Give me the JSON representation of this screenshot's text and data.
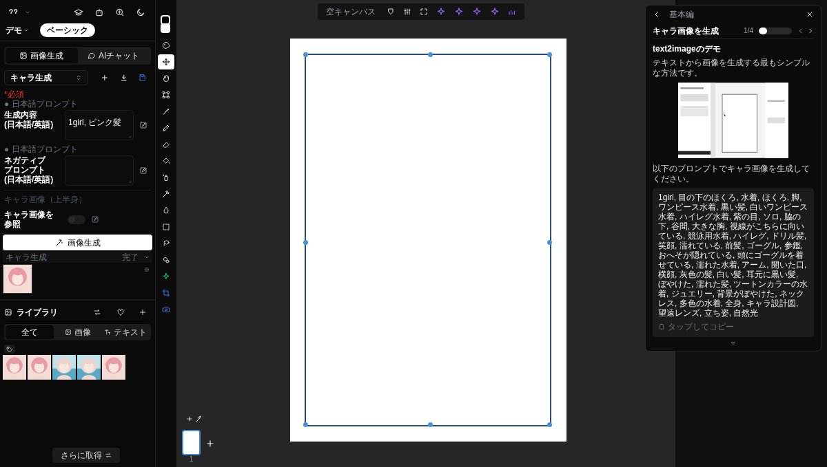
{
  "header": {
    "project": "デモ",
    "plan": "ベーシック"
  },
  "mode_tabs": [
    {
      "label": "画像生成",
      "selected": true
    },
    {
      "label": "AIチャット",
      "selected": false
    }
  ],
  "preset": {
    "value": "キャラ生成"
  },
  "prompts": [
    {
      "required": "*必須",
      "hint": "● 日本語プロンプト",
      "label_lines": [
        "生成内容",
        "(日本語/英語)"
      ],
      "value": "1girl, ピンク髪"
    },
    {
      "hint": "● 日本語プロンプト",
      "label_lines": [
        "ネガティブ",
        "プロンプト",
        "(日本語/英語)"
      ]
    }
  ],
  "char_section": "キャラ画像（上半身）",
  "reference": {
    "label_lines": [
      "キャラ画像を",
      "参照"
    ],
    "on": false
  },
  "generate_button": "画像生成",
  "job": {
    "name": "キャラ生成",
    "status": "完了"
  },
  "library": {
    "title": "ライブラリ",
    "tabs": [
      {
        "label": "全て",
        "selected": true
      },
      {
        "label": "画像",
        "selected": false
      },
      {
        "label": "テキスト",
        "selected": false
      }
    ],
    "more_button": "さらに取得"
  },
  "tools": [
    {
      "kind": "palette",
      "selected": false
    },
    {
      "kind": "move",
      "selected": true
    },
    {
      "kind": "hand",
      "selected": false
    },
    {
      "kind": "transform",
      "selected": false
    },
    {
      "kind": "brush",
      "selected": false
    },
    {
      "kind": "pencil",
      "selected": false
    },
    {
      "kind": "eraser",
      "selected": false
    },
    {
      "kind": "fill",
      "selected": false
    },
    {
      "kind": "spray",
      "selected": false
    },
    {
      "kind": "dropper",
      "selected": false
    },
    {
      "kind": "drop",
      "selected": false
    },
    {
      "kind": "select",
      "selected": false
    },
    {
      "kind": "lasso",
      "selected": false
    },
    {
      "kind": "magic",
      "selected": false
    },
    {
      "kind": "sparkle",
      "selected": false
    },
    {
      "kind": "crop",
      "selected": false
    },
    {
      "kind": "camera",
      "selected": false
    }
  ],
  "canvas_toolbar": {
    "label": "空キャンバス"
  },
  "tutorial": {
    "section": "基本編",
    "title": "キャラ画像を生成",
    "step": "1/4",
    "level": 0.25,
    "heading": "text2imageのデモ",
    "intro": "テキストから画像を生成する最もシンプルな方法です。",
    "instruction": "以下のプロンプトでキャラ画像を生成してください。",
    "prompt": "1girl, 目の下のほくろ, 水着, ほくろ, 脚, ワンピース水着, 黒い髪, 白いワンピース水着, ハイレグ水着, 紫の目, ソロ, 脇の下, 谷間, 大きな胸, 視線がこちらに向いている, 競泳用水着, ハイレグ, ドリル髪, 笑顔, 濡れている, 前髪, ゴーグル, 参鑑, おへそが隠れている, 頭にゴーグルを着せている, 濡れた水着, アーム, 開いた口, 横顔, 灰色の髪, 白い髪, 耳元に黒い髪, ぼやけた, 濡れた髪, ツートンカラーの水着, ジュエリー, 背景がぼやけた, ネックレス, 多色の水着, 全身, キャラ設計図, 望遠レンズ, 立ち姿, 自然光",
    "copy_hint": "タップしてコピー"
  },
  "pages": [
    {
      "number": "1",
      "selected": true
    }
  ]
}
